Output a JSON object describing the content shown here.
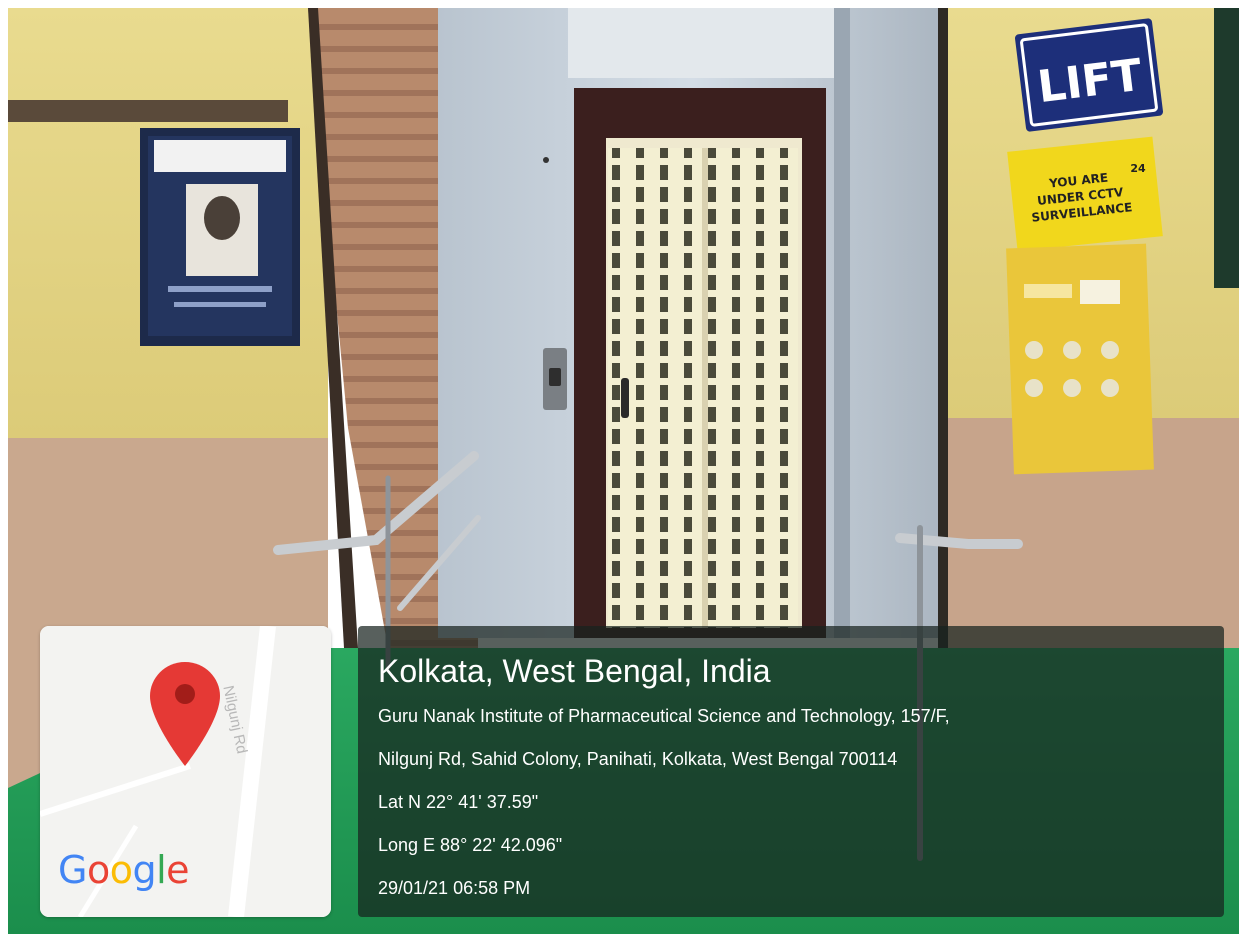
{
  "scene": {
    "lift_sign": "LIFT",
    "cctv_sign": [
      "YOU ARE",
      "UNDER CCTV",
      "SURVEILLANCE"
    ],
    "cctv_badge": "24"
  },
  "map_card": {
    "road_label": "Nilgunj Rd",
    "logo": {
      "letters": [
        "G",
        "o",
        "o",
        "g",
        "l",
        "e"
      ],
      "colors": [
        "#4285F4",
        "#EA4335",
        "#FBBC05",
        "#4285F4",
        "#34A853",
        "#EA4335"
      ]
    },
    "pin_color": "#E53935"
  },
  "overlay": {
    "location_title": "Kolkata, West Bengal, India",
    "address_line_1": "Guru Nanak Institute of Pharmaceutical Science and Technology, 157/F,",
    "address_line_2": "Nilgunj Rd, Sahid Colony, Panihati, Kolkata, West Bengal 700114",
    "latitude": "Lat N 22° 41' 37.59\"",
    "longitude": "Long E 88° 22' 42.096\"",
    "timestamp": "29/01/21 06:58 PM"
  }
}
